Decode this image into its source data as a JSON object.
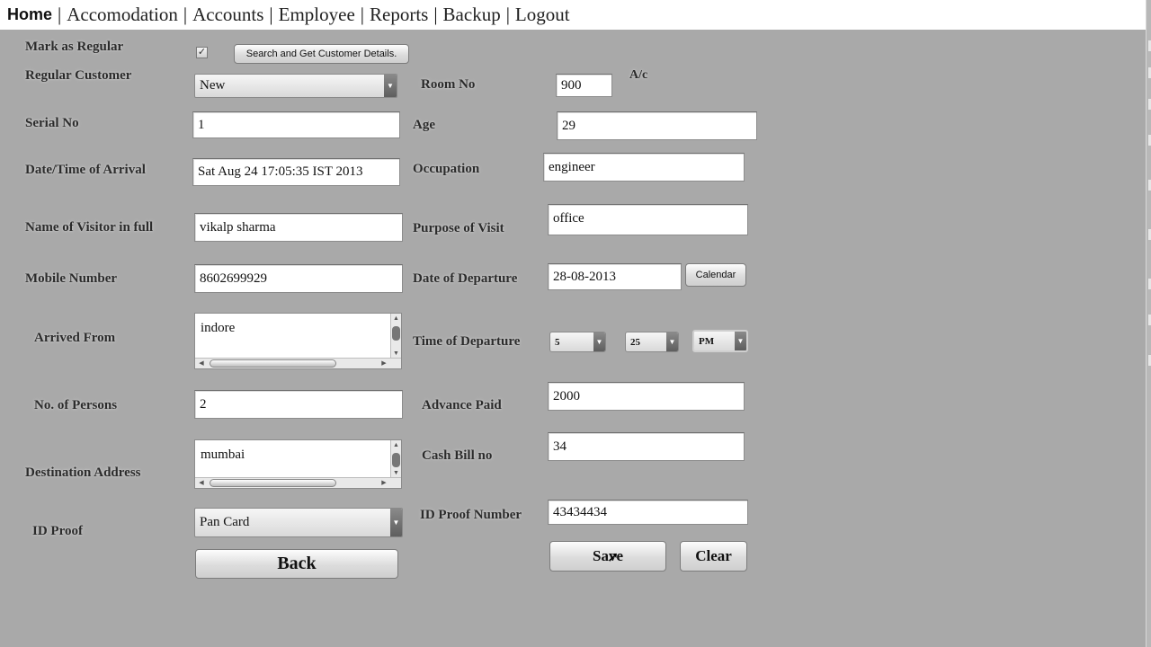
{
  "menu": {
    "home": "Home",
    "items": [
      "Accomodation",
      "Accounts",
      "Employee",
      "Reports",
      "Backup",
      "Logout"
    ]
  },
  "form": {
    "mark_regular_label": "Mark as Regular",
    "mark_regular_checked": true,
    "search_button": "Search and Get Customer Details.",
    "regular_customer_label": "Regular Customer",
    "regular_customer_value": "New",
    "serial_no_label": "Serial No",
    "serial_no_value": "1",
    "arrival_label": "Date/Time of Arrival",
    "arrival_value": "Sat Aug 24 17:05:35 IST 2013",
    "visitor_name_label": "Name of Visitor in full",
    "visitor_name_value": "vikalp sharma",
    "mobile_label": "Mobile Number",
    "mobile_value": "8602699929",
    "arrived_from_label": "Arrived From",
    "arrived_from_value": "indore",
    "persons_label": "No. of Persons",
    "persons_value": "2",
    "destination_label": "Destination Address",
    "destination_value": "mumbai",
    "id_proof_label": "ID Proof",
    "id_proof_value": "Pan Card",
    "back_button": "Back",
    "room_no_label": "Room No",
    "room_no_value": "900",
    "ac_label": "A/c",
    "age_label": "Age",
    "age_value": "29",
    "occupation_label": "Occupation",
    "occupation_value": "engineer",
    "purpose_label": "Purpose of Visit",
    "purpose_value": "office",
    "departure_date_label": "Date of Departure",
    "departure_date_value": "28-08-2013",
    "calendar_button": "Calendar",
    "departure_time_label": "Time of Departure",
    "departure_hour": "5",
    "departure_minute": "25",
    "departure_ampm": "PM",
    "advance_label": "Advance Paid",
    "advance_value": "2000",
    "cash_bill_label": "Cash Bill no",
    "cash_bill_value": "34",
    "id_number_label": "ID Proof Number",
    "id_number_value": "43434434",
    "save_button": "Save",
    "clear_button": "Clear"
  }
}
